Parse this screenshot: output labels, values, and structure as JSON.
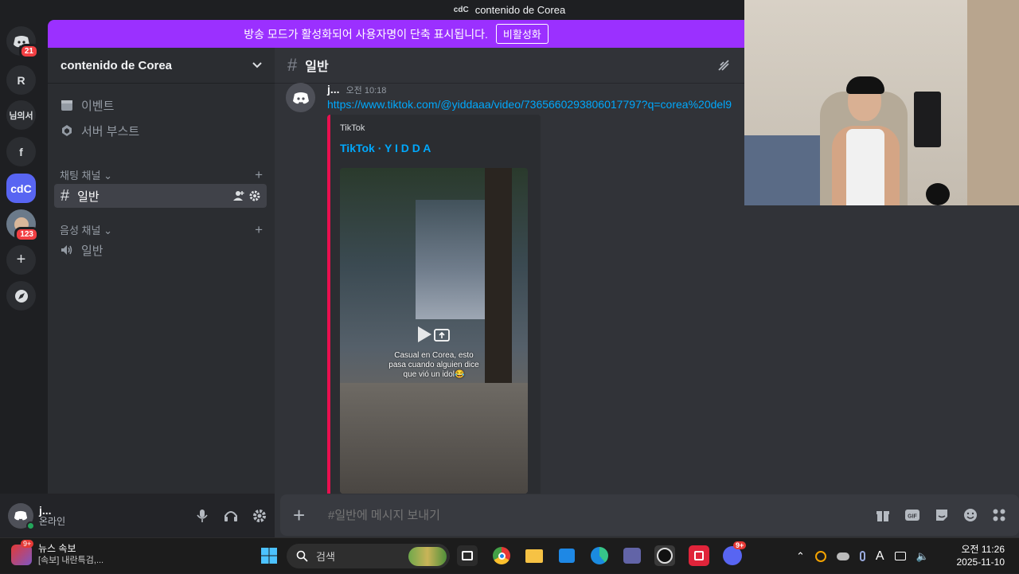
{
  "window": {
    "title": "contenido de Corea",
    "logo": "cdC"
  },
  "notice": {
    "text": "방송 모드가 활성화되어 사용자명이 단축 표시됩니다.",
    "button": "비활성화"
  },
  "rail": {
    "servers": [
      {
        "label": "",
        "icon": "discord-logo-icon",
        "badge": "21"
      },
      {
        "label": "R"
      },
      {
        "label": "님의서"
      },
      {
        "label": "f"
      },
      {
        "label": "cdC",
        "active": true
      },
      {
        "label": "",
        "icon": "avatar",
        "badge": "123"
      },
      {
        "label": "+",
        "icon": "add-server-icon"
      },
      {
        "label": "",
        "icon": "discover-icon"
      }
    ]
  },
  "sidebar": {
    "server_name": "contenido de Corea",
    "items": [
      {
        "label": "이벤트",
        "icon": "calendar-icon"
      },
      {
        "label": "서버 부스트",
        "icon": "boost-icon"
      }
    ],
    "text_category": "채팅 채널",
    "text_channels": [
      {
        "label": "일반",
        "icon": "hash-icon"
      }
    ],
    "voice_category": "음성 채널",
    "voice_channels": [
      {
        "label": "일반",
        "icon": "speaker-icon"
      }
    ]
  },
  "user": {
    "name": "j...",
    "status": "온라인"
  },
  "chat": {
    "channel": "일반",
    "message": {
      "author": "j...",
      "time": "오전 10:18",
      "link": "https://www.tiktok.com/@yiddaaa/video/7365660293806017797?q=corea%20del9",
      "embed": {
        "provider": "TikTok",
        "title": "TikTok · Y I D D A",
        "caption_line1": "Casual en Corea, esto",
        "caption_line2": "pasa cuando alguien dice",
        "caption_line3": "que vió un idol😂"
      }
    },
    "composer_placeholder": "#일반에 메시지 보내기"
  },
  "taskbar": {
    "news_title": "뉴스 속보",
    "news_sub": "[속보] 내란특검,...",
    "news_badge": "9+",
    "search_placeholder": "검색",
    "discord_badge": "9+",
    "time": "오전 11:26",
    "date": "2025-11-10",
    "ime": "A"
  },
  "colors": {
    "accent": "#5865f2",
    "notice": "#9b30ff",
    "embed_border": "#e9104f",
    "link": "#00a8fc",
    "online": "#23a55a"
  }
}
